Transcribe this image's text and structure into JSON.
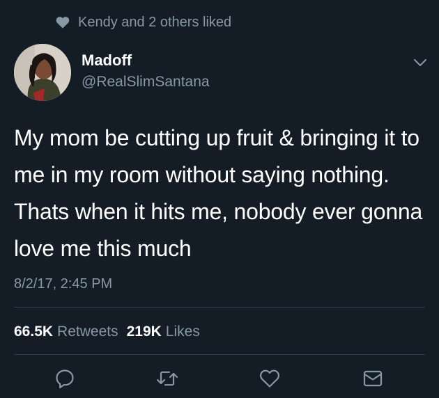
{
  "social_context": {
    "icon": "heart-icon",
    "text": "Kendy and 2 others liked"
  },
  "author": {
    "name": "Madoff",
    "handle": "@RealSlimSantana"
  },
  "tweet": {
    "text": "My mom be cutting up fruit & bringing it to me in my room without saying nothing. Thats when it hits me, nobody ever gonna love me this much",
    "timestamp": "8/2/17, 2:45 PM"
  },
  "stats": {
    "retweets_count": "66.5K",
    "retweets_label": "Retweets",
    "likes_count": "219K",
    "likes_label": "Likes"
  },
  "actions": [
    {
      "name": "reply",
      "icon": "reply-bubble-icon"
    },
    {
      "name": "retweet",
      "icon": "retweet-icon"
    },
    {
      "name": "like",
      "icon": "heart-outline-icon"
    },
    {
      "name": "message",
      "icon": "envelope-icon"
    }
  ],
  "colors": {
    "background": "#141d26",
    "secondary_text": "#8899a6",
    "divider": "#2f3d4a"
  }
}
